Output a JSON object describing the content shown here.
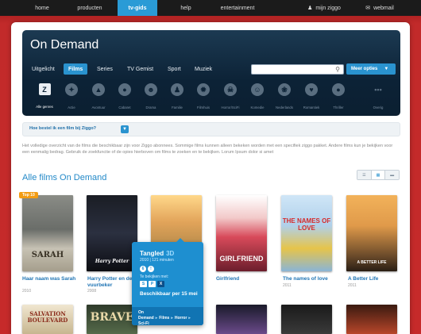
{
  "topnav": {
    "items": [
      {
        "label": "home"
      },
      {
        "label": "producten"
      },
      {
        "label": "tv-gids"
      },
      {
        "label": "help"
      },
      {
        "label": "entertainment"
      },
      {
        "label": "mijn ziggo",
        "icon": "user-icon"
      },
      {
        "label": "webmail",
        "icon": "mail-icon"
      }
    ],
    "active": "tv-gids"
  },
  "header": {
    "title": "On Demand",
    "tabs": [
      {
        "label": "Uitgelicht"
      },
      {
        "label": "Films"
      },
      {
        "label": "Series"
      },
      {
        "label": "TV Gemist"
      },
      {
        "label": "Sport"
      },
      {
        "label": "Muziek"
      }
    ],
    "active_tab": "Films",
    "search": {
      "placeholder": "",
      "value": ""
    },
    "more_options": "Meer opties"
  },
  "genres": [
    {
      "label": "Alle genres",
      "icon": "ziggo-z-icon"
    },
    {
      "label": "Actie",
      "icon": "action-icon"
    },
    {
      "label": "Avontuur",
      "icon": "adventure-icon"
    },
    {
      "label": "Cabaret",
      "icon": "microphone-icon"
    },
    {
      "label": "Drama",
      "icon": "drama-masks-icon"
    },
    {
      "label": "Familie",
      "icon": "family-icon"
    },
    {
      "label": "Filmhuis",
      "icon": "film-reel-icon"
    },
    {
      "label": "Horror/SciFi",
      "icon": "skull-icon"
    },
    {
      "label": "Komedie",
      "icon": "comedy-icon"
    },
    {
      "label": "Nederlands",
      "icon": "tulip-icon"
    },
    {
      "label": "Romantiek",
      "icon": "heart-icon"
    },
    {
      "label": "Thriller",
      "icon": "thriller-icon"
    },
    {
      "label": "Overig",
      "icon": "more-dots-icon"
    }
  ],
  "infobar": {
    "link": "Hoe bestel ik een film bij Ziggo?"
  },
  "description": "Het volledige overzicht van de films die beschikbaar zijn voor Ziggo abonnees. Sommige films kunnen alleen bekeken worden met een specifiek ziggo pakket. Andere films kun je bekijken voor een eenmalig bedrag. Gebruik de zoekfunctie of de opies hierboven om films te zoeken en te bekijken. Lorum Ipsum dolor si amet",
  "section": {
    "title": "Alle films On Demand"
  },
  "badge_top10": "Top 10",
  "films": [
    {
      "title": "Haar naam was Sarah",
      "year": "2010",
      "poster_text": "SARAH"
    },
    {
      "title": "Harry Potter en de vuurbeker",
      "year": "2008",
      "poster_text": "Harry Potter"
    },
    {
      "title": "Tangled",
      "year": "",
      "poster_text": ""
    },
    {
      "title": "Girlfriend",
      "year": "",
      "poster_text": "GIRLFRIEND"
    },
    {
      "title": "The names of love",
      "year": "2011",
      "poster_text": "THE NAMES OF LOVE"
    },
    {
      "title": "A Better Life",
      "year": "2011",
      "poster_text": "A BETTER LIFE"
    }
  ],
  "row2_posters": [
    "SALVATION BOULEVARD",
    "BRAVE",
    "",
    "",
    "",
    ""
  ],
  "popup": {
    "title": "Tangled",
    "format": "3D",
    "meta": "2010 | 121 minuten",
    "watch_with": "Te bekijken met:",
    "services": [
      "S",
      "P",
      "X"
    ],
    "available": "Beschikbaar per 15 mei",
    "crumbs": [
      "On Demand",
      "Films",
      "Horror",
      "Sci-Fi"
    ]
  },
  "colors": {
    "accent": "#2a93cf",
    "background": "#c62a2a",
    "header_bg": "#0c2236"
  }
}
